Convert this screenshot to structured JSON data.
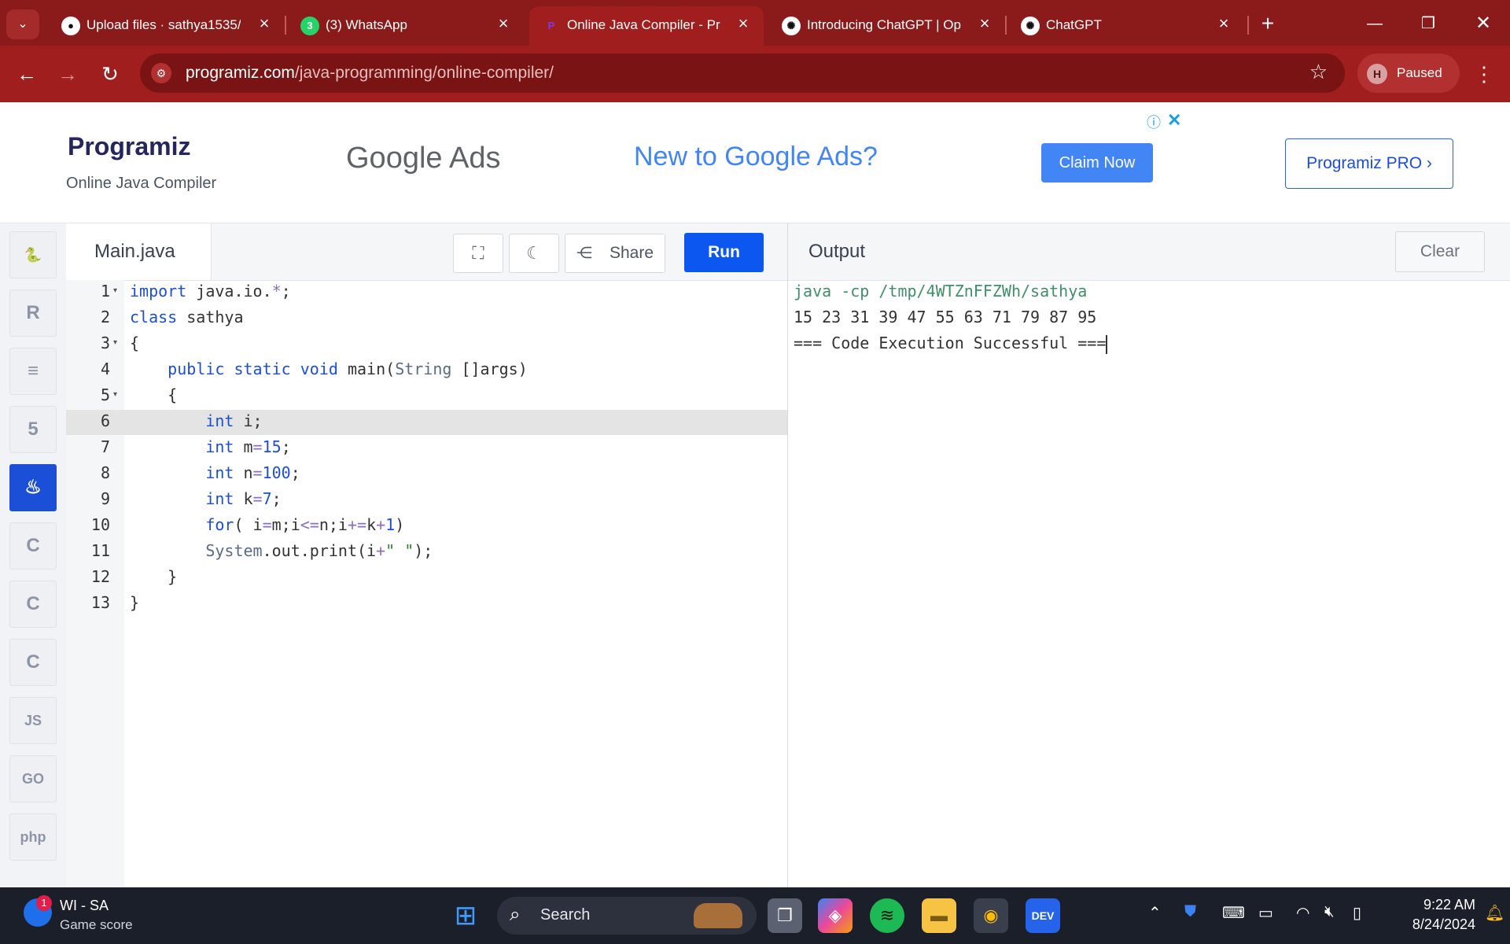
{
  "browser": {
    "tabs": [
      {
        "title": "Upload files · sathya1535/",
        "favicon": "github-icon",
        "active": false
      },
      {
        "title": "(3) WhatsApp",
        "favicon": "whatsapp-icon",
        "badge": "3",
        "active": false
      },
      {
        "title": "Online Java Compiler - Pr",
        "favicon": "programiz-icon",
        "active": true
      },
      {
        "title": "Introducing ChatGPT | Op",
        "favicon": "openai-icon",
        "active": false
      },
      {
        "title": "ChatGPT",
        "favicon": "openai-icon",
        "active": false
      }
    ],
    "address": {
      "domain": "programiz.com",
      "path": "/java-programming/online-compiler/"
    },
    "profile": {
      "initial": "H",
      "status": "Paused"
    },
    "theme_color": "#8b1a1a"
  },
  "header": {
    "logo": "Programiz",
    "subtitle": "Online Java Compiler",
    "ad": {
      "brand": "Google Ads",
      "headline": "New to Google Ads?",
      "cta": "Claim Now"
    },
    "pro_button": "Programiz PRO ›"
  },
  "rail": {
    "languages": [
      {
        "name": "Python",
        "icon": "python-icon",
        "glyph": "🐍"
      },
      {
        "name": "R",
        "icon": "r-icon",
        "glyph": "R"
      },
      {
        "name": "SQL",
        "icon": "database-icon",
        "glyph": "≡"
      },
      {
        "name": "HTML",
        "icon": "html5-icon",
        "glyph": "5"
      },
      {
        "name": "Java",
        "icon": "java-icon",
        "glyph": "♨",
        "active": true
      },
      {
        "name": "C",
        "icon": "c-icon",
        "glyph": "C"
      },
      {
        "name": "C++",
        "icon": "cpp-icon",
        "glyph": "C"
      },
      {
        "name": "C#",
        "icon": "csharp-icon",
        "glyph": "C"
      },
      {
        "name": "JavaScript",
        "icon": "js-icon",
        "glyph": "JS"
      },
      {
        "name": "Go",
        "icon": "go-icon",
        "glyph": "GO"
      },
      {
        "name": "PHP",
        "icon": "php-icon",
        "glyph": "php"
      }
    ]
  },
  "editor": {
    "filename": "Main.java",
    "share_label": "Share",
    "run_label": "Run",
    "active_line": 6,
    "lines": [
      "import java.io.*;",
      "class sathya",
      "{",
      "    public static void main(String []args)",
      "    {",
      "        int i;",
      "        int m=15;",
      "        int n=100;",
      "        int k=7;",
      "        for( i=m;i<=n;i+=k+1)",
      "        System.out.print(i+\" \");",
      "    }",
      "}"
    ]
  },
  "output": {
    "title": "Output",
    "clear_label": "Clear",
    "lines": [
      "java -cp /tmp/4WTZnFFZWh/sathya",
      "15 23 31 39 47 55 63 71 79 87 95",
      "=== Code Execution Successful ==="
    ]
  },
  "taskbar": {
    "weather": {
      "title": "WI - SA",
      "subtitle": "Game score",
      "badge": "1"
    },
    "search_placeholder": "Search",
    "time": "9:22 AM",
    "date": "8/24/2024"
  }
}
